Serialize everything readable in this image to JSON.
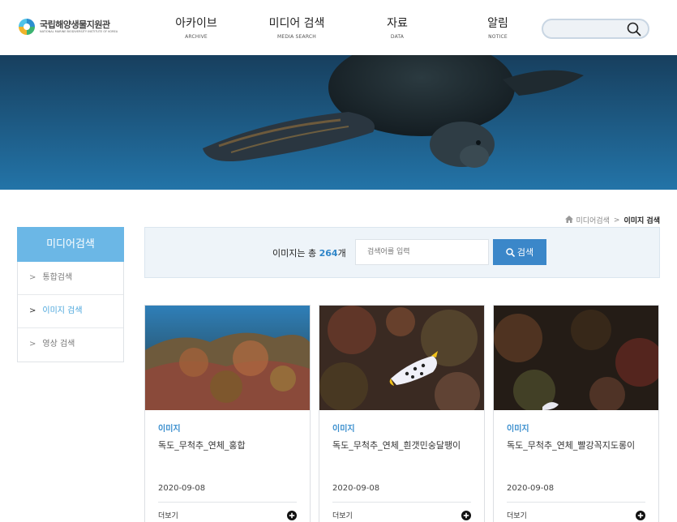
{
  "header": {
    "logo_ko": "국립해양생물지원관",
    "logo_en": "NATIONAL MARINE BIODIVERSITY INSTITUTE OF KOREA",
    "nav": [
      {
        "ko": "아카이브",
        "en": "ARCHIVE"
      },
      {
        "ko": "미디어 검색",
        "en": "MEDIA SEARCH"
      },
      {
        "ko": "자료",
        "en": "DATA"
      },
      {
        "ko": "알림",
        "en": "NOTICE"
      }
    ],
    "search_placeholder": ""
  },
  "breadcrumb": {
    "home_icon": "home-icon",
    "parent": "미디어검색",
    "separator": ">",
    "current": "이미지 검색"
  },
  "sidebar": {
    "title": "미디어검색",
    "items": [
      {
        "label": "통합검색",
        "active": false
      },
      {
        "label": "이미지 검색",
        "active": true
      },
      {
        "label": "영상 검색",
        "active": false
      }
    ]
  },
  "search_panel": {
    "count_prefix": "이미지는 총 ",
    "count": "264",
    "count_suffix": "개",
    "input_placeholder": "검색어를 입력",
    "button_label": "검색"
  },
  "cards": [
    {
      "category": "이미지",
      "title": "독도_무척추_연체_홍합",
      "date": "2020-09-08",
      "more": "더보기"
    },
    {
      "category": "이미지",
      "title": "독도_무척추_연체_흰갯민숭달팽이",
      "date": "2020-09-08",
      "more": "더보기"
    },
    {
      "category": "이미지",
      "title": "독도_무척추_연체_빨강꼭지도롱이",
      "date": "2020-09-08",
      "more": "더보기"
    }
  ],
  "colors": {
    "accent": "#6bb7e6",
    "button": "#3b87c9",
    "highlight": "#2f86c9"
  }
}
